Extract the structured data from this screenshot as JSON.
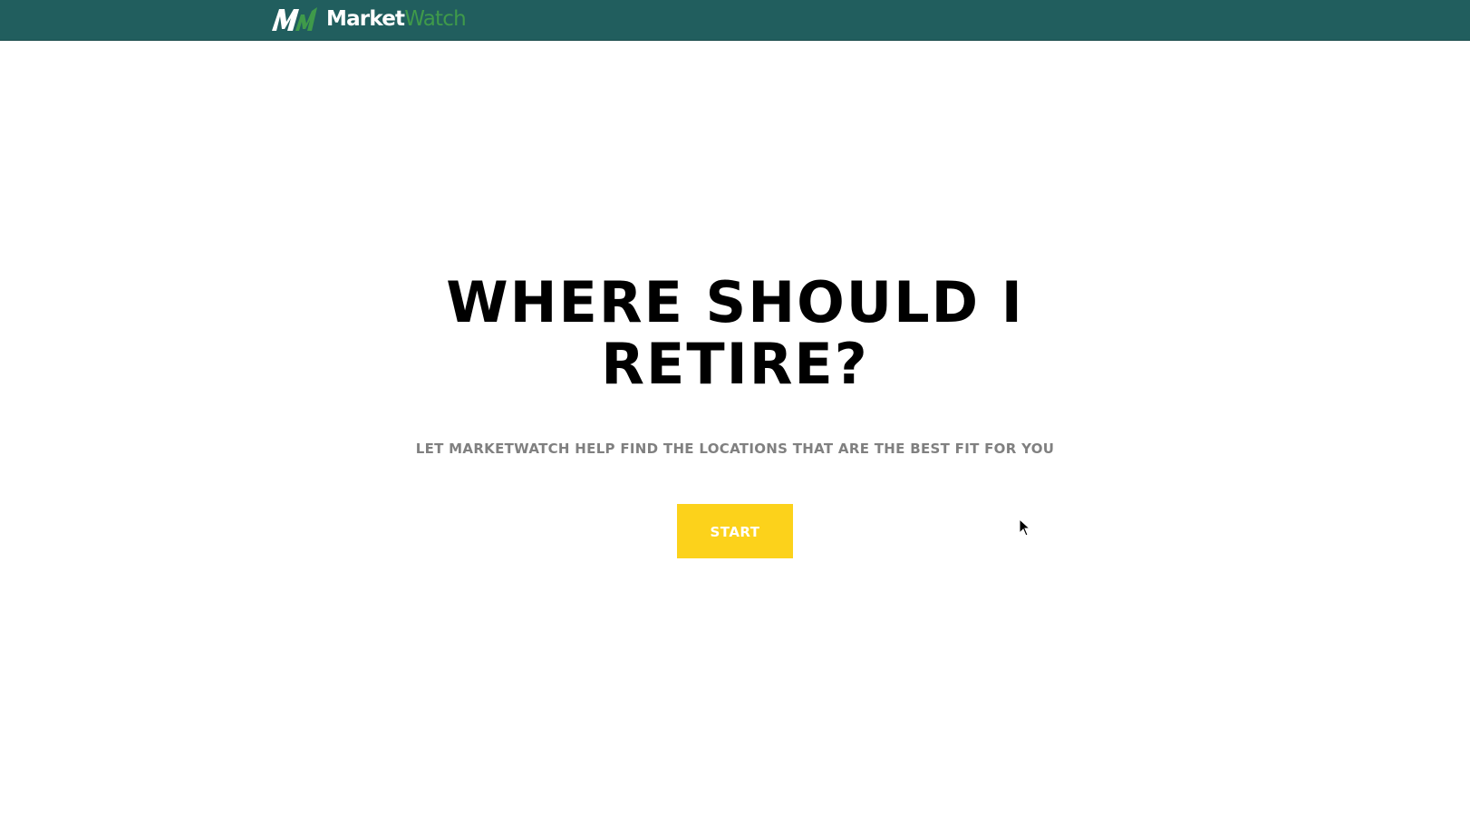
{
  "header": {
    "logo": {
      "brand_primary": "Market",
      "brand_secondary": "Watch",
      "icon": "marketwatch-logo-icon"
    },
    "background_color": "#215e5e",
    "accent_color": "#3f9a4a"
  },
  "hero": {
    "title": "WHERE SHOULD I RETIRE?",
    "subtitle": "LET MARKETWATCH HELP FIND THE LOCATIONS THAT ARE THE BEST FIT FOR YOU",
    "start_button_label": "START",
    "start_button_color": "#fcd21b"
  },
  "cursor": {
    "icon": "mouse-pointer-icon"
  }
}
